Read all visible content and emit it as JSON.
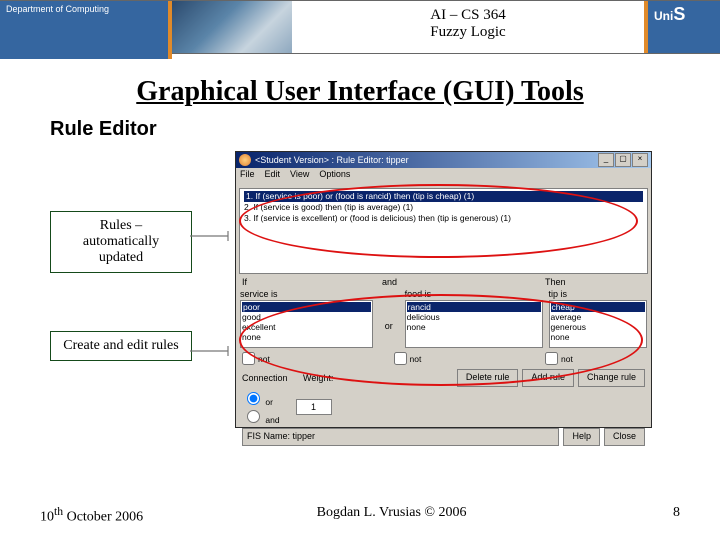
{
  "header": {
    "dept": "Department of Computing",
    "course": "AI – CS 364",
    "topic": "Fuzzy Logic",
    "unis": "UniS"
  },
  "slide_title": "Graphical User Interface (GUI) Tools",
  "subtitle": "Rule Editor",
  "callouts": {
    "rules": "Rules – automatically updated",
    "create": "Create and edit rules"
  },
  "app": {
    "title": "<Student Version> : Rule Editor: tipper",
    "menu": [
      "File",
      "Edit",
      "View",
      "Options"
    ],
    "rules": [
      "1. If (service is poor) or (food is rancid) then (tip is cheap) (1)",
      "2. If (service is good) then (tip is average) (1)",
      "3. If (service is excellent) or (food is delicious) then (tip is generous) (1)"
    ],
    "col_labels": {
      "if": "If",
      "and": "and",
      "then": "Then"
    },
    "inputs": {
      "service_label": "service is",
      "service": [
        "poor",
        "good",
        "excellent",
        "none"
      ],
      "food_label": "food is",
      "food": [
        "rancid",
        "delicious",
        "none"
      ],
      "tip_label": "tip is",
      "tip": [
        "cheap",
        "average",
        "generous",
        "none"
      ]
    },
    "not_label": "not",
    "conn_label": "Connection",
    "conn_or": "or",
    "conn_and": "and",
    "weight_label": "Weight:",
    "weight_value": "1",
    "buttons": {
      "del": "Delete rule",
      "add": "Add rule",
      "chg": "Change rule"
    },
    "fis_label": "FIS Name: tipper",
    "help": "Help",
    "close": "Close"
  },
  "footer": {
    "date_pre": "10",
    "date_sup": "th",
    "date_post": " October 2006",
    "author": "Bogdan L. Vrusias © 2006",
    "page": "8"
  }
}
